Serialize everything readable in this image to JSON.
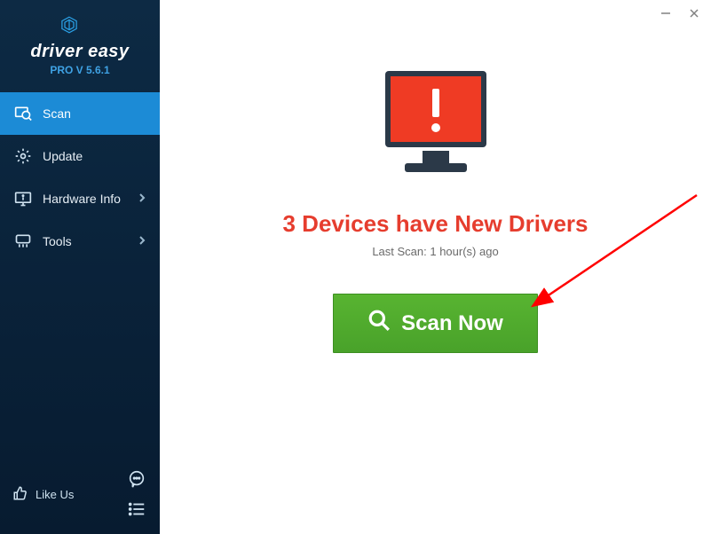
{
  "app": {
    "name": "driver easy",
    "version_line": "PRO V 5.6.1"
  },
  "nav": {
    "scan": "Scan",
    "update": "Update",
    "hardware_info": "Hardware Info",
    "tools": "Tools"
  },
  "sidebar_bottom": {
    "like_us": "Like Us"
  },
  "main": {
    "headline": "3 Devices have New Drivers",
    "last_scan": "Last Scan: 1 hour(s) ago",
    "scan_button": "Scan Now"
  }
}
